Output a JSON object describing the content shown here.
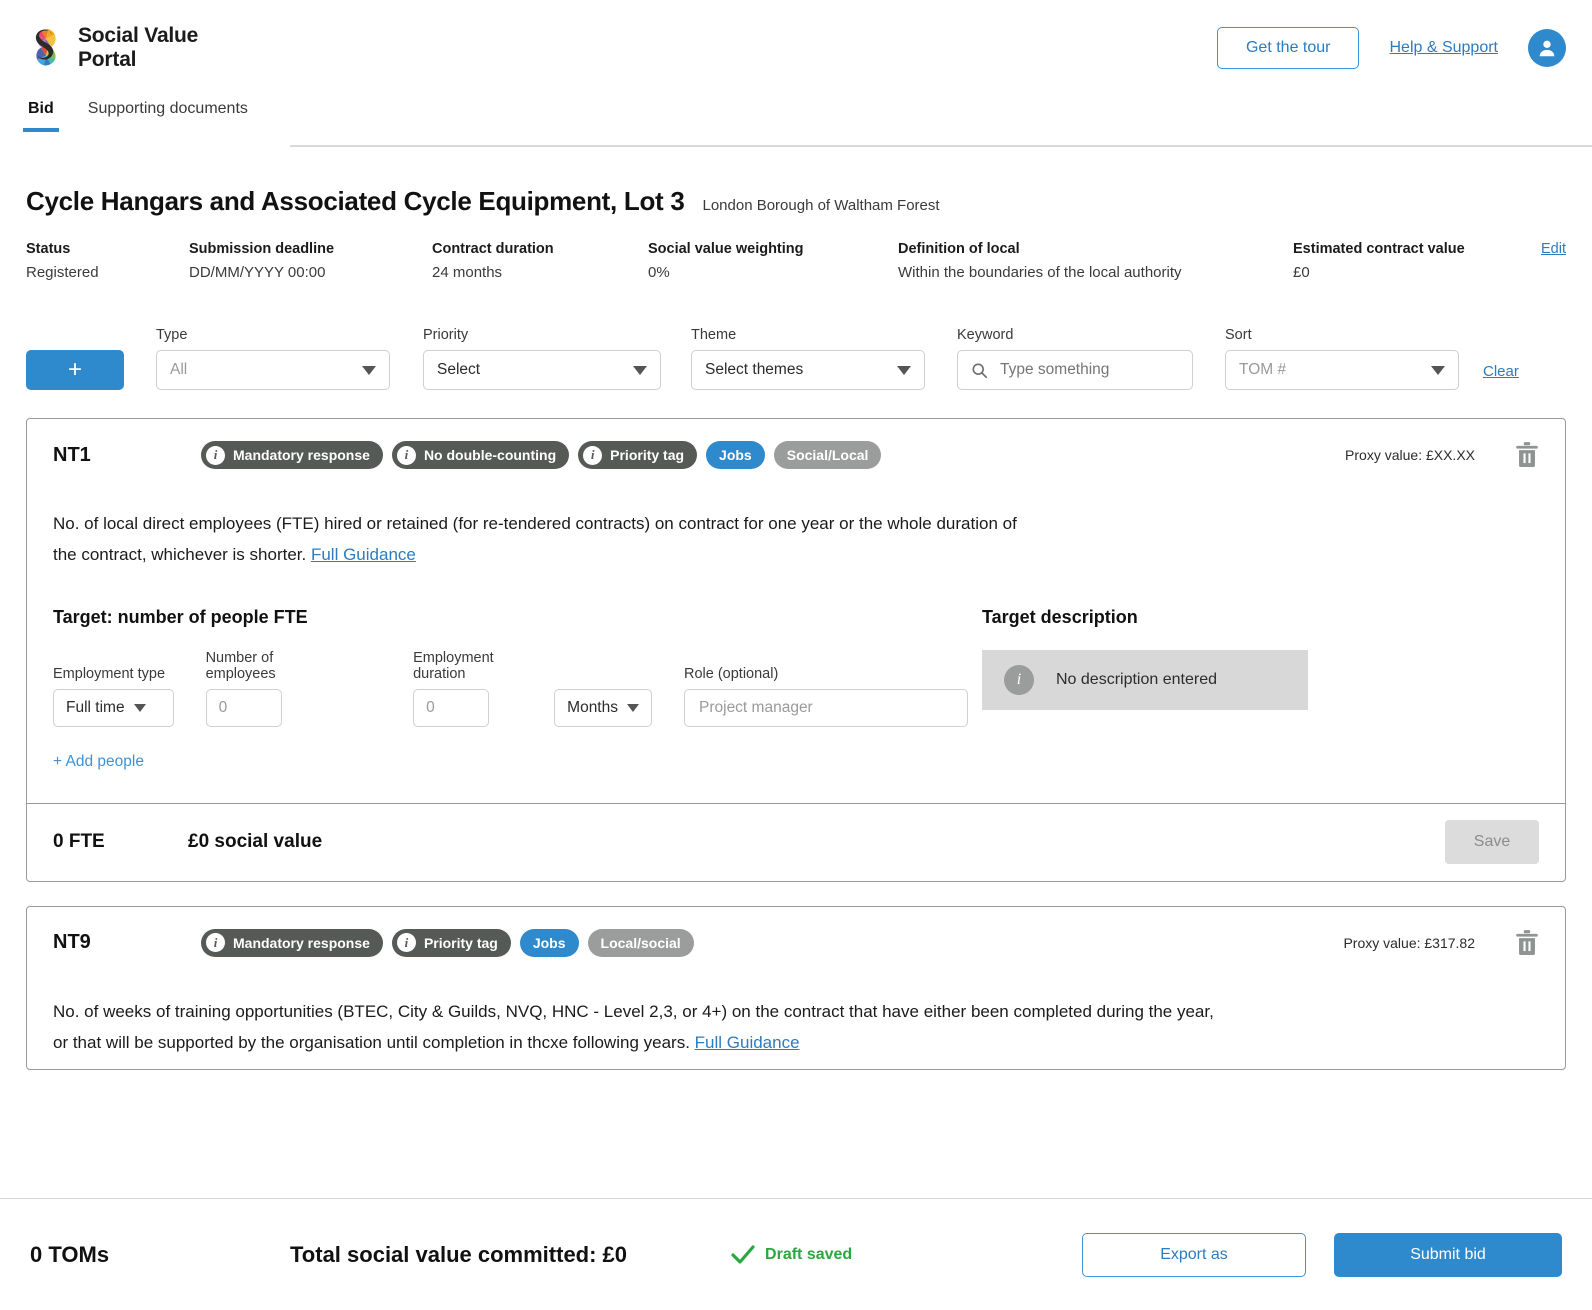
{
  "brand": {
    "name": "Social Value\nPortal",
    "logo_icon": "social-value-portal-swirl-logo"
  },
  "header": {
    "tour_button": "Get the tour",
    "help_link": "Help & Support",
    "avatar_icon": "user-avatar-icon"
  },
  "tabs": [
    {
      "label": "Bid",
      "active": true
    },
    {
      "label": "Supporting documents",
      "active": false
    }
  ],
  "bid": {
    "title": "Cycle Hangars and Associated Cycle Equipment, Lot 3",
    "organisation": "London Borough of Waltham Forest",
    "edit_link": "Edit",
    "meta": [
      {
        "label": "Status",
        "value": "Registered"
      },
      {
        "label": "Submission deadline",
        "value": "DD/MM/YYYY 00:00"
      },
      {
        "label": "Contract duration",
        "value": "24 months"
      },
      {
        "label": "Social value weighting",
        "value": "0%"
      },
      {
        "label": "Definition of local",
        "value": "Within the boundaries of the local authority"
      },
      {
        "label": "Estimated contract value",
        "value": "£0"
      }
    ]
  },
  "filters": {
    "add_button": "+",
    "type": {
      "label": "Type",
      "value": "All"
    },
    "priority": {
      "label": "Priority",
      "value": "Select"
    },
    "theme": {
      "label": "Theme",
      "value": "Select themes"
    },
    "keyword": {
      "label": "Keyword",
      "placeholder": "Type something",
      "value": ""
    },
    "sort": {
      "label": "Sort",
      "value": "TOM #"
    },
    "clear_link": "Clear"
  },
  "cards": [
    {
      "code": "NT1",
      "tags": [
        {
          "text": "Mandatory response",
          "style": "dark",
          "info": true
        },
        {
          "text": "No double-counting",
          "style": "dark",
          "info": true
        },
        {
          "text": "Priority tag",
          "style": "dark",
          "info": true
        },
        {
          "text": "Jobs",
          "style": "blue",
          "info": false
        },
        {
          "text": "Social/Local",
          "style": "grey",
          "info": false
        }
      ],
      "proxy_value": "Proxy value: £XX.XX",
      "description": "No. of local direct employees (FTE) hired or retained (for re-tendered contracts) on contract for one year or the whole duration of the contract, whichever is shorter.",
      "guidance_link": "Full Guidance",
      "target_title": "Target: number of people FTE",
      "description_title": "Target description",
      "description_empty": "No description entered",
      "fields": {
        "employment_type": {
          "label": "Employment type",
          "value": "Full time"
        },
        "number_of_employees": {
          "label": "Number of employees",
          "placeholder": "0",
          "value": ""
        },
        "employment_duration": {
          "label": "Employment duration",
          "placeholder": "0",
          "value": ""
        },
        "duration_unit": {
          "value": "Months"
        },
        "role": {
          "label": "Role (optional)",
          "placeholder": "Project manager",
          "value": ""
        }
      },
      "add_people_link": "+ Add people",
      "footer_fte": "0 FTE",
      "footer_social_value": "£0 social value",
      "save_label": "Save"
    },
    {
      "code": "NT9",
      "tags": [
        {
          "text": "Mandatory response",
          "style": "dark",
          "info": true
        },
        {
          "text": "Priority tag",
          "style": "dark",
          "info": true
        },
        {
          "text": "Jobs",
          "style": "blue",
          "info": false
        },
        {
          "text": "Local/social",
          "style": "grey",
          "info": false
        }
      ],
      "proxy_value": "Proxy value: £317.82",
      "description": "No. of weeks of training opportunities (BTEC, City & Guilds, NVQ, HNC - Level 2,3, or 4+) on the contract that have either been completed during the year, or that will be supported by the organisation until completion in thcxe following years.",
      "guidance_link": "Full Guidance"
    }
  ],
  "bottom": {
    "toms_count": "0 TOMs",
    "total_social_value": "Total social value committed: £0",
    "draft_status": "Draft saved",
    "draft_icon": "check-icon",
    "export_label": "Export as",
    "submit_label": "Submit bid"
  },
  "colors": {
    "accent_blue": "#2f89cd",
    "link_blue": "#2b7cc0",
    "tag_dark": "#555a57",
    "tag_grey": "#9a9d9b",
    "success_green": "#2aa83f"
  }
}
